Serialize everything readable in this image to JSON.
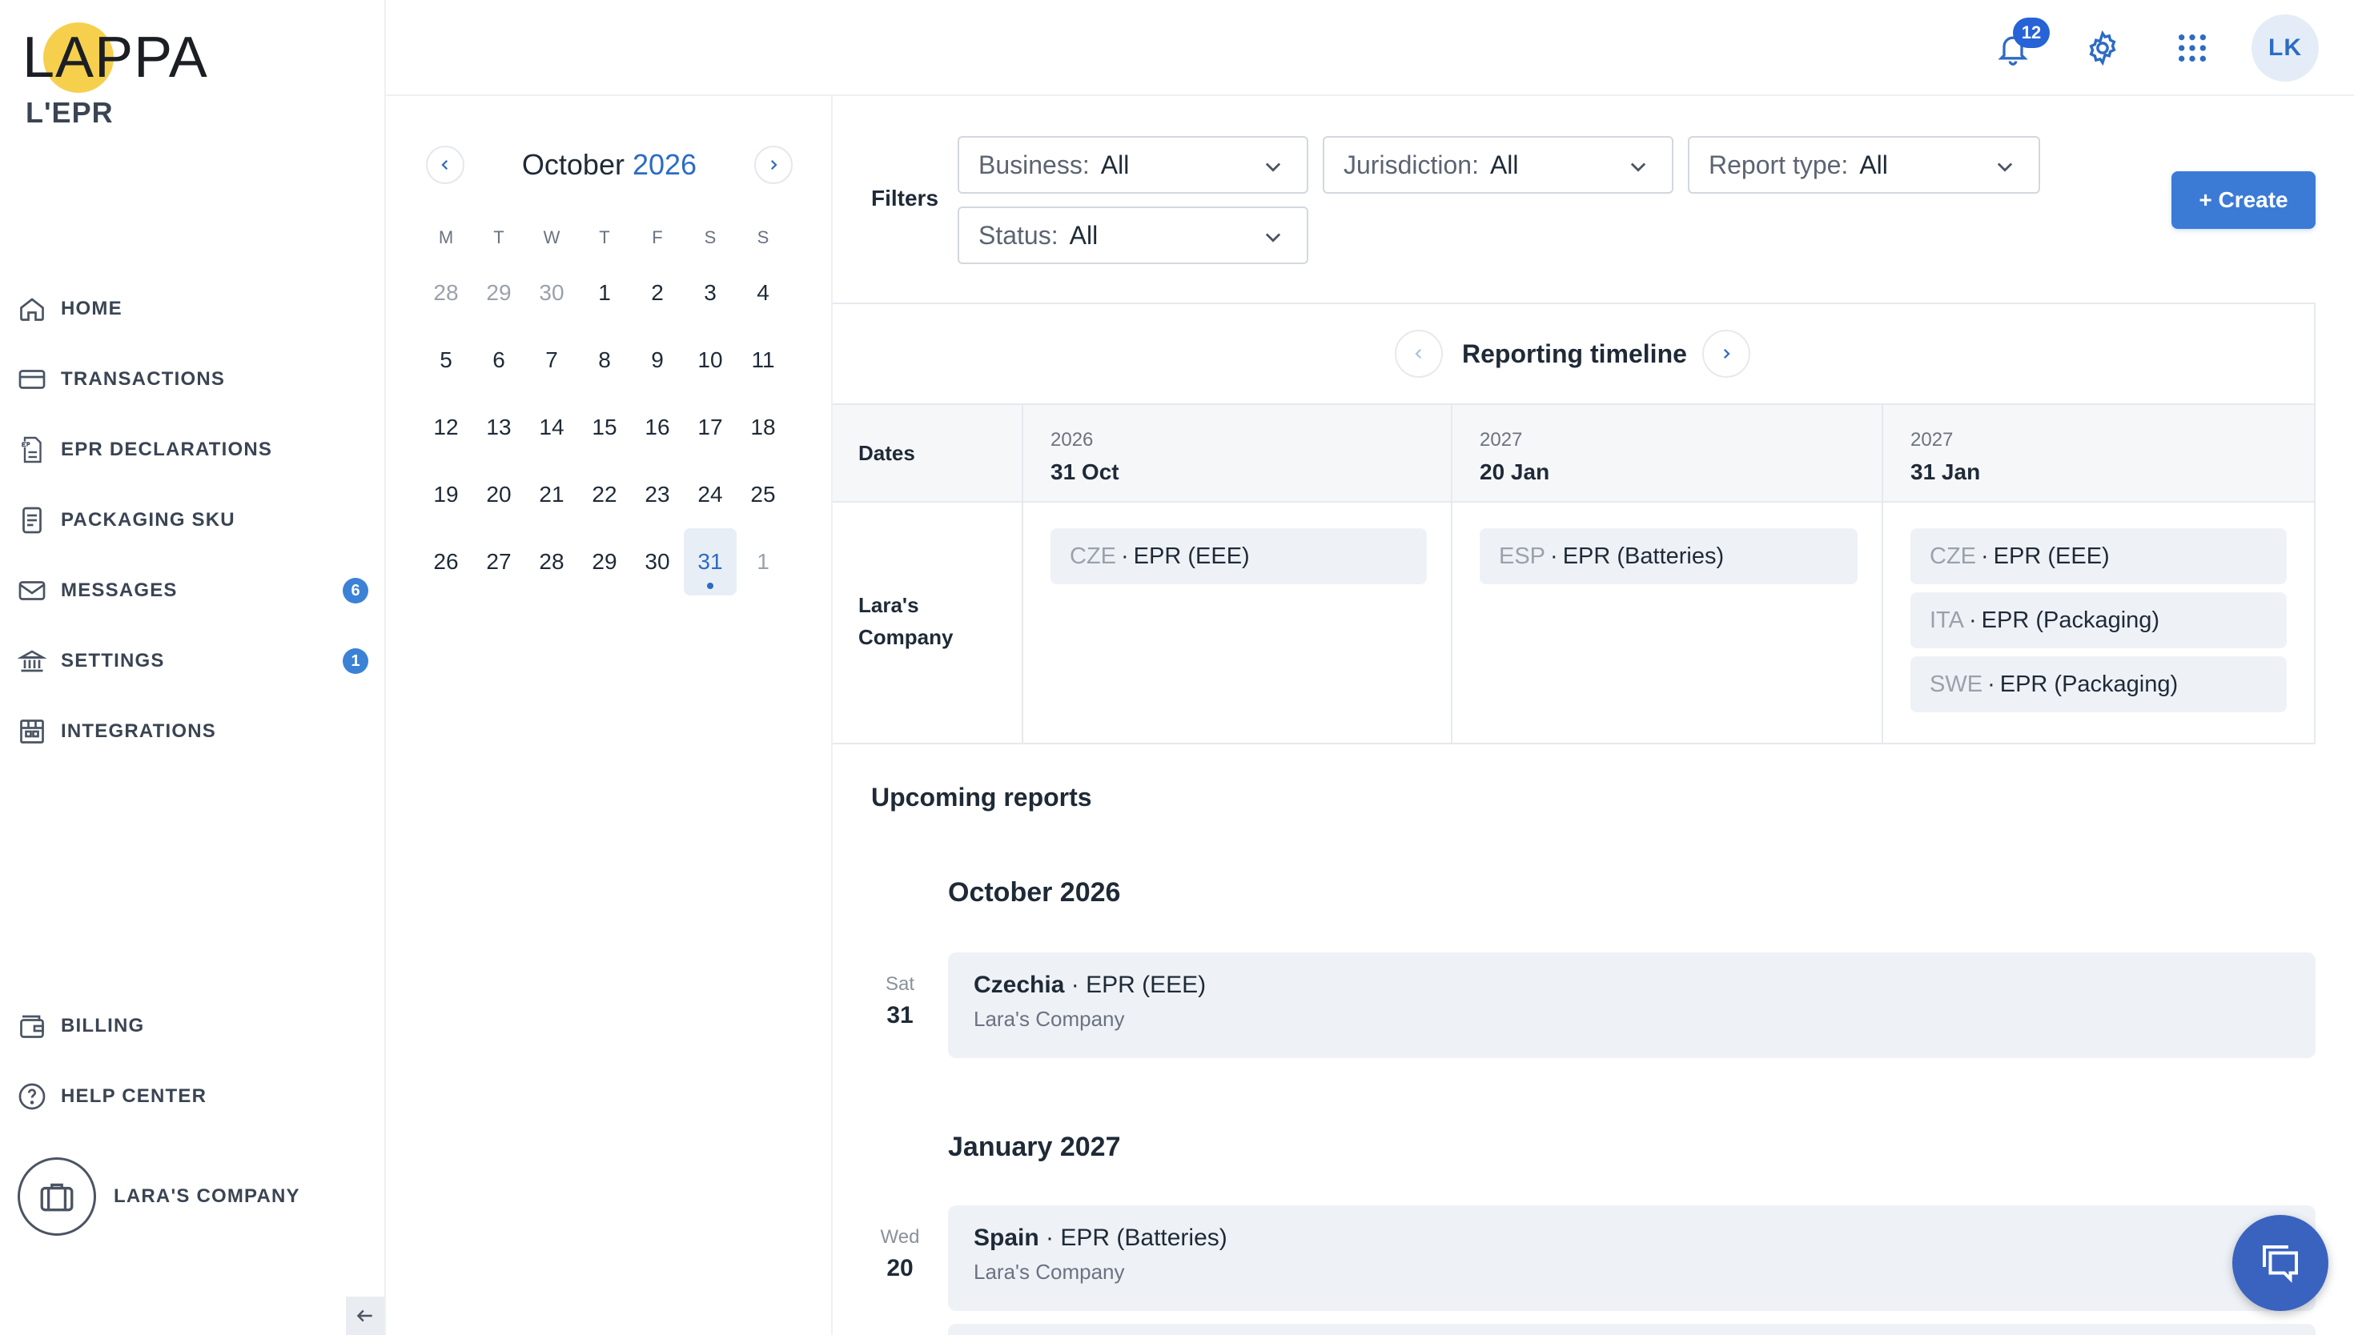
{
  "brand": {
    "logo_text": "LAPPA",
    "app_name": "L'EPR",
    "accent": "#3b7bd6",
    "logo_yellow": "#f6d04d"
  },
  "sidebar": {
    "items": [
      {
        "label": "HOME",
        "icon": "home-icon"
      },
      {
        "label": "TRANSACTIONS",
        "icon": "credit-card-icon"
      },
      {
        "label": "EPR DECLARATIONS",
        "icon": "epr-document-icon"
      },
      {
        "label": "PACKAGING SKU",
        "icon": "document-icon"
      },
      {
        "label": "MESSAGES",
        "icon": "mail-icon",
        "badge": "6"
      },
      {
        "label": "SETTINGS",
        "icon": "bank-icon",
        "badge": "1"
      },
      {
        "label": "INTEGRATIONS",
        "icon": "building-icon"
      }
    ],
    "bottom_items": [
      {
        "label": "BILLING",
        "icon": "wallet-icon"
      },
      {
        "label": "HELP CENTER",
        "icon": "help-circle-icon"
      }
    ],
    "company": "LARA'S COMPANY"
  },
  "topbar": {
    "notifications": "12",
    "user_initials": "LK"
  },
  "calendar": {
    "month": "October",
    "year": "2026",
    "weekdays": [
      "M",
      "T",
      "W",
      "T",
      "F",
      "S",
      "S"
    ],
    "weeks": [
      [
        "28",
        "29",
        "30",
        "1",
        "2",
        "3",
        "4"
      ],
      [
        "5",
        "6",
        "7",
        "8",
        "9",
        "10",
        "11"
      ],
      [
        "12",
        "13",
        "14",
        "15",
        "16",
        "17",
        "18"
      ],
      [
        "19",
        "20",
        "21",
        "22",
        "23",
        "24",
        "25"
      ],
      [
        "26",
        "27",
        "28",
        "29",
        "30",
        "31",
        "1"
      ]
    ],
    "selected": "31"
  },
  "filters": {
    "label": "Filters",
    "business": {
      "label": "Business:",
      "value": "All"
    },
    "jurisdiction": {
      "label": "Jurisdiction:",
      "value": "All"
    },
    "report_type": {
      "label": "Report type:",
      "value": "All"
    },
    "status": {
      "label": "Status:",
      "value": "All"
    },
    "create_label": "+ Create"
  },
  "timeline": {
    "title": "Reporting timeline",
    "dates_label": "Dates",
    "company_label": "Lara's Company",
    "columns": [
      {
        "year": "2026",
        "date": "31 Oct",
        "chips": [
          {
            "code": "CZE",
            "type": "EPR (EEE)"
          }
        ]
      },
      {
        "year": "2027",
        "date": "20 Jan",
        "chips": [
          {
            "code": "ESP",
            "type": "EPR (Batteries)"
          }
        ]
      },
      {
        "year": "2027",
        "date": "31 Jan",
        "chips": [
          {
            "code": "CZE",
            "type": "EPR (EEE)"
          },
          {
            "code": "ITA",
            "type": "EPR (Packaging)"
          },
          {
            "code": "SWE",
            "type": "EPR (Packaging)"
          }
        ]
      }
    ]
  },
  "upcoming": {
    "title": "Upcoming reports",
    "groups": [
      {
        "month": "October 2026",
        "reports": [
          {
            "weekday": "Sat",
            "day": "31",
            "country": "Czechia",
            "type": "EPR (EEE)",
            "company": "Lara's Company"
          }
        ]
      },
      {
        "month": "January 2027",
        "reports": [
          {
            "weekday": "Wed",
            "day": "20",
            "country": "Spain",
            "type": "EPR (Batteries)",
            "company": "Lara's Company"
          }
        ]
      }
    ],
    "separator": "·"
  }
}
